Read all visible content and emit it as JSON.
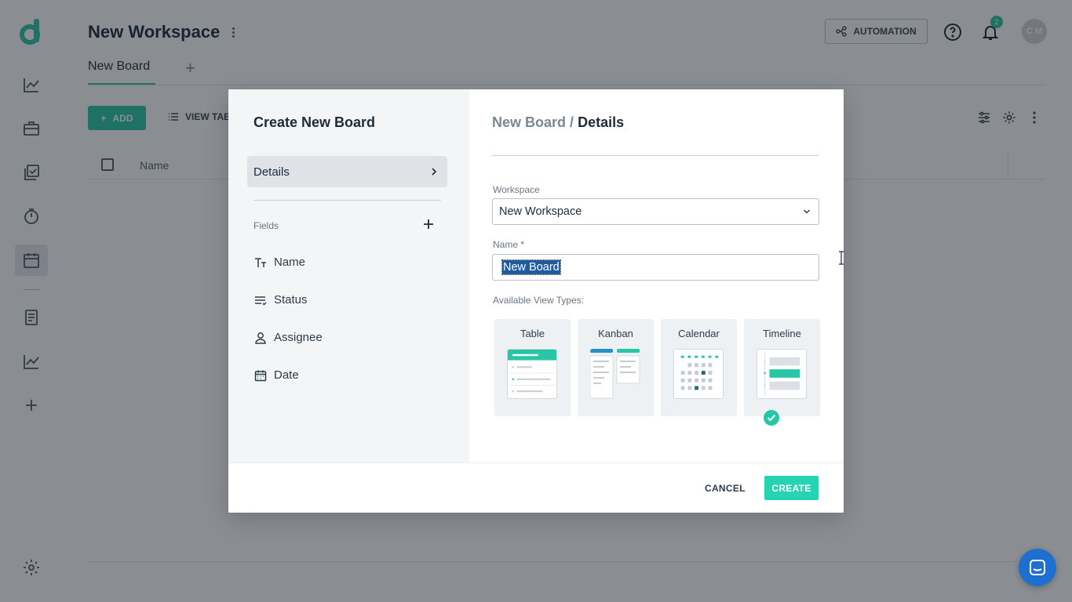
{
  "app": {
    "workspace_title": "New Workspace",
    "tabs": [
      {
        "label": "New Board"
      }
    ],
    "header": {
      "automation_label": "AUTOMATION",
      "notification_count": "2",
      "avatar_initials": "C M"
    },
    "toolbar": {
      "add_label": "ADD",
      "view_label": "VIEW TAB"
    },
    "table": {
      "columns": [
        "Name"
      ]
    }
  },
  "modal": {
    "title": "Create New Board",
    "nav": {
      "details_label": "Details"
    },
    "fields_label": "Fields",
    "fields": [
      {
        "label": "Name",
        "icon": "text-type-icon"
      },
      {
        "label": "Status",
        "icon": "status-list-icon"
      },
      {
        "label": "Assignee",
        "icon": "person-icon"
      },
      {
        "label": "Date",
        "icon": "calendar-icon"
      }
    ],
    "breadcrumb": {
      "parent": "New Board",
      "separator": "/",
      "current": "Details"
    },
    "workspace": {
      "label": "Workspace",
      "value": "New Workspace"
    },
    "name": {
      "label": "Name *",
      "value": "New Board"
    },
    "view_types_label": "Available View Types:",
    "view_types": [
      {
        "label": "Table",
        "checked": true
      },
      {
        "label": "Kanban",
        "checked": true
      },
      {
        "label": "Calendar",
        "checked": true
      },
      {
        "label": "Timeline",
        "checked": true
      }
    ],
    "footer": {
      "cancel_label": "CANCEL",
      "create_label": "CREATE"
    }
  },
  "colors": {
    "accent": "#26c6a6",
    "create_button": "#26d4b3",
    "chat": "#1f6fd0"
  }
}
